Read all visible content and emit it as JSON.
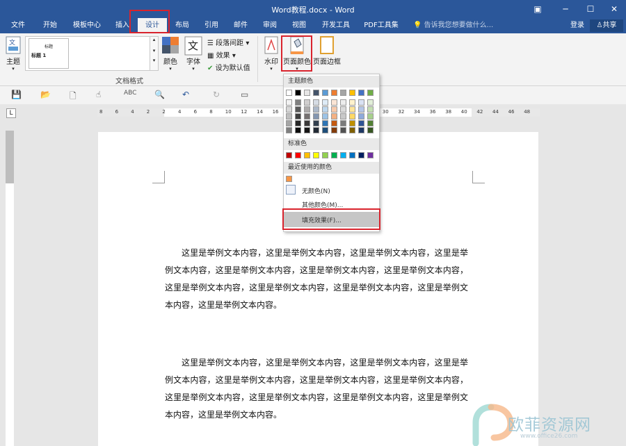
{
  "window": {
    "title": "Word教程.docx - Word"
  },
  "tabs": [
    "文件",
    "开始",
    "模板中心",
    "插入",
    "设计",
    "布局",
    "引用",
    "邮件",
    "审阅",
    "视图",
    "开发工具",
    "PDF工具集"
  ],
  "active_tab": "设计",
  "tell_me": "告诉我您想要做什么...",
  "signin": "登录",
  "share": "共享",
  "ribbon": {
    "theme": "主题",
    "gallery_title": "标题",
    "gallery_heading": "标题 1",
    "colors": "颜色",
    "fonts": "字体",
    "paragraph_spacing": "段落间距",
    "effects": "效果",
    "set_default": "设为默认值",
    "group_label": "文档格式",
    "watermark": "水印",
    "page_color": "页面颜色",
    "page_borders": "页面边框"
  },
  "ruler": {
    "h_ticks": [
      "8",
      "6",
      "4",
      "2",
      "2",
      "4",
      "6",
      "8",
      "10",
      "12",
      "14",
      "16",
      "18",
      "20",
      "22",
      "24",
      "26",
      "28",
      "30",
      "32",
      "34",
      "36",
      "38",
      "40",
      "42",
      "44",
      "46",
      "48"
    ],
    "corner": "L"
  },
  "colors": {
    "accent": "#2b579a",
    "highlight": "#d9232d",
    "theme_top": [
      "#ffffff",
      "#000000",
      "#e7e6e6",
      "#44546a",
      "#5b9bd5",
      "#ed7d31",
      "#a5a5a5",
      "#ffc000",
      "#4472c4",
      "#70ad47"
    ],
    "theme_shades": [
      [
        "#f2f2f2",
        "#7f7f7f",
        "#d0cece",
        "#d6dce4",
        "#deebf6",
        "#fbe5d5",
        "#ededed",
        "#fff2cc",
        "#d9e2f3",
        "#e2efd9"
      ],
      [
        "#d8d8d8",
        "#595959",
        "#aeabab",
        "#adb9ca",
        "#bdd7ee",
        "#f8cbad",
        "#dbdbdb",
        "#fee599",
        "#b4c6e7",
        "#c5e0b3"
      ],
      [
        "#bfbfbf",
        "#3f3f3f",
        "#757070",
        "#8496b0",
        "#9dc3e6",
        "#f4b183",
        "#c9c9c9",
        "#ffd965",
        "#8eaadb",
        "#a8d08d"
      ],
      [
        "#a5a5a5",
        "#262626",
        "#3a3838",
        "#323f4f",
        "#2e75b5",
        "#c55a11",
        "#7b7b7b",
        "#bf9000",
        "#2f5496",
        "#538135"
      ],
      [
        "#7f7f7f",
        "#0c0c0c",
        "#171616",
        "#222a35",
        "#1e4e79",
        "#833c0b",
        "#525252",
        "#7f6000",
        "#1f3864",
        "#375623"
      ]
    ],
    "standard": [
      "#c00000",
      "#ff0000",
      "#ffc000",
      "#ffff00",
      "#92d050",
      "#00b050",
      "#00b0f0",
      "#0070c0",
      "#002060",
      "#7030a0"
    ],
    "recent": [
      "#f79646"
    ]
  },
  "dropdown": {
    "theme_colors": "主题颜色",
    "standard_colors": "标准色",
    "recent_colors": "最近使用的颜色",
    "no_color": "无颜色(N)",
    "more_colors": "其他颜色(M)...",
    "fill_effects": "填充效果(F)..."
  },
  "document": {
    "paragraph1": "这里是举例文本内容，这里是举例文本内容，这里是举例文本内容，这里是举例文本内容，这里是举例文本内容，这里是举例文本内容，这里是举例文本内容，这里是举例文本内容，这里是举例文本内容，这里是举例文本内容，这里是举例文本内容，这里是举例文本内容。",
    "paragraph2": "这里是举例文本内容，这里是举例文本内容，这里是举例文本内容，这里是举例文本内容，这里是举例文本内容，这里是举例文本内容，这里是举例文本内容，这里是举例文本内容，这里是举例文本内容，这里是举例文本内容，这里是举例文本内容，这里是举例文本内容。"
  },
  "watermark_text": "欧菲资源网",
  "watermark_url": "www.office26.com"
}
